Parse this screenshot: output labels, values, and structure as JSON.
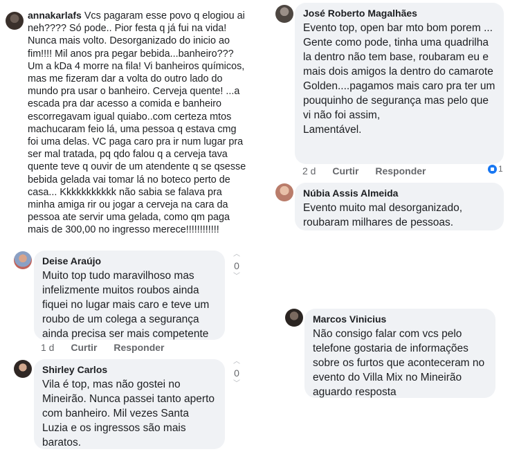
{
  "comments": {
    "annakarla": {
      "author": "annakarlafs",
      "text": "Vcs pagaram esse povo q elogiou ai neh???? Só pode.. Pior festa q já fui na vida! Nunca mais volto. Desorganizado do inicio ao fim!!!! Mil anos pra pegar bebida...banheiro??? Um a kDa 4 morre na fila! Vi banheiros químicos, mas me fizeram dar a volta do outro lado do mundo pra usar o banheiro. Cerveja quente! ...a escada pra dar acesso a comida e banheiro escorregavam igual quiabo..com certeza mtos machucaram feio lá, uma pessoa q estava cmg foi uma delas. VC paga caro pra ir num lugar pra ser mal tratada, pq qdo falou q a cerveja tava quente teve q ouvir de um atendente q se qsesse bebida gelada vai tomar lá no boteco perto de casa... Kkkkkkkkkkk não sabia se falava pra minha amiga rir ou jogar a cerveja na cara da pessoa ate servir uma gelada, como qm paga mais de 300,00 no ingresso merece!!!!!!!!!!!!"
    },
    "jose": {
      "author": "José Roberto Magalhães",
      "text": "Evento top, open bar mto bom porem ...\nGente como pode, tinha uma quadrilha la dentro não tem base, roubaram eu e mais dois amigos la dentro do camarote Golden....pagamos mais caro pra ter um pouquinho de segurança mas pelo que vi não foi assim,\nLamentável.",
      "time": "2 d",
      "like_label": "Curtir",
      "reply_label": "Responder",
      "reaction_count": "1"
    },
    "nubia": {
      "author": "Núbia Assis Almeida",
      "text": "Evento muito mal desorganizado, roubaram milhares de pessoas."
    },
    "deise": {
      "author": "Deise Araújo",
      "text": "Muito top tudo maravilhoso mas infelizmente muitos roubos ainda fiquei no lugar mais caro e teve um roubo de um colega a segurança ainda precisa ser mais competente",
      "time": "1 d",
      "like_label": "Curtir",
      "reply_label": "Responder",
      "votes": "0"
    },
    "shirley": {
      "author": "Shirley Carlos",
      "text": "Vila é top, mas não gostei no Mineirão. Nunca passei tanto aperto com banheiro. Mil vezes Santa Luzia e os ingressos são mais baratos.",
      "votes": "0"
    },
    "marcos": {
      "author": "Marcos Vinicius",
      "text": "Não consigo falar com vcs pelo telefone gostaria de informações sobre os furtos que aconteceram no evento do Villa Mix no Mineirão aguardo resposta"
    }
  },
  "icons": {
    "upvote": "up-caret-icon",
    "downvote": "down-caret-icon",
    "like_reaction": "like-reaction-icon"
  },
  "colors": {
    "bubble_bg": "#f0f2f5",
    "meta_text": "#65676b",
    "reaction_blue": "#1877f2"
  }
}
